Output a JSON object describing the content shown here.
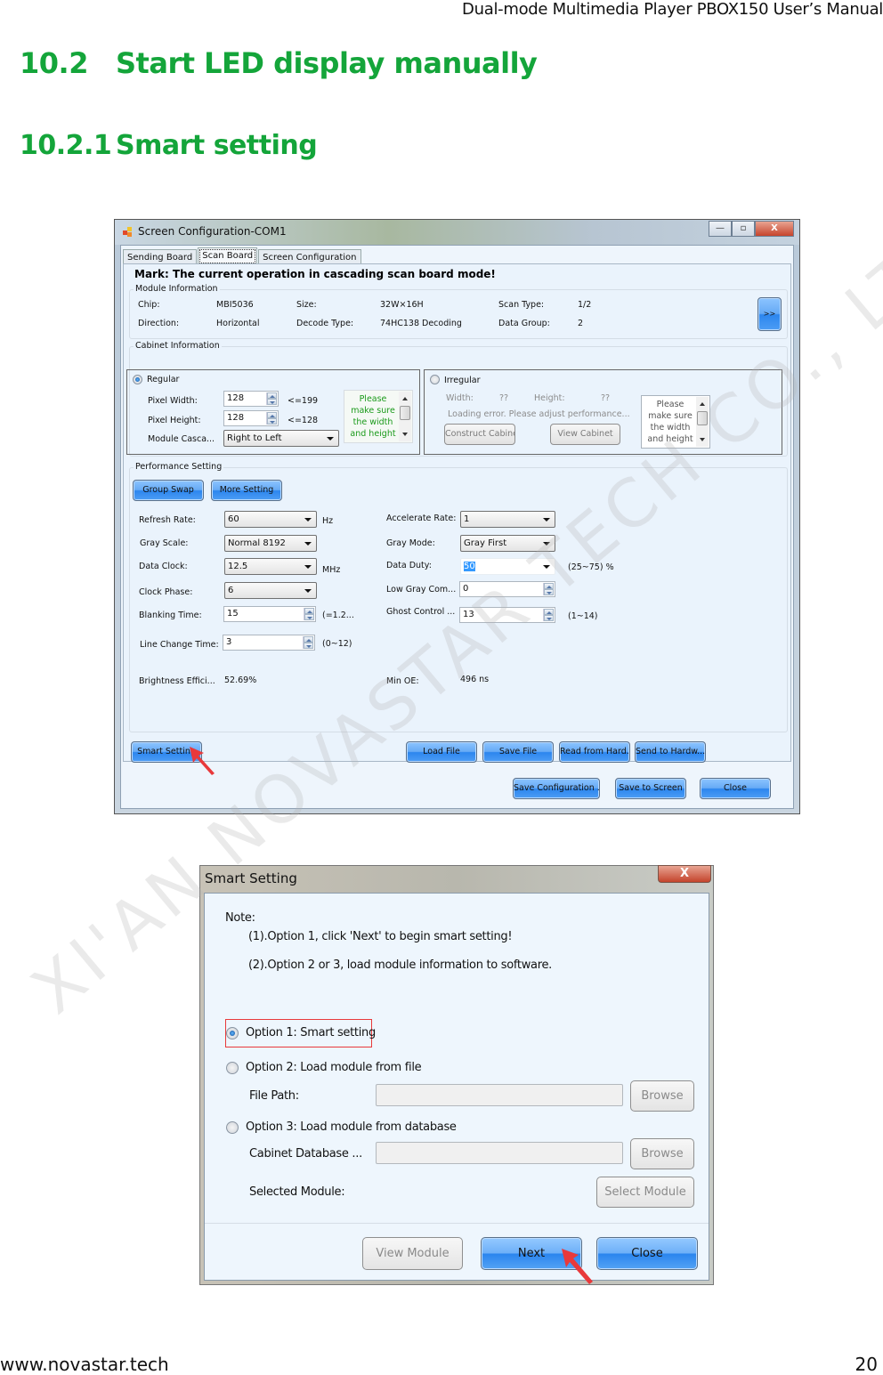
{
  "document": {
    "header": "Dual-mode Multimedia Player PBOX150 User’s Manual",
    "section": {
      "number": "10.2",
      "title": "Start LED display manually"
    },
    "subsection": {
      "number": "10.2.1",
      "title": "Smart setting"
    },
    "footer": {
      "website": "www.novastar.tech",
      "page": "20"
    },
    "watermark": "XI'AN NOVASTAR TECH CO., LTD"
  },
  "screen_config": {
    "title": "Screen Configuration-COM1",
    "window_buttons": {
      "minimize": "—",
      "maximize": "▫",
      "close": "X"
    },
    "tabs": [
      {
        "label": "Sending Board",
        "active": false
      },
      {
        "label": "Scan Board",
        "active": true
      },
      {
        "label": "Screen Configuration",
        "active": false
      }
    ],
    "mark": "Mark: The current operation in cascading scan board mode!",
    "module_info": {
      "label": "Module Information",
      "chip_label": "Chip:",
      "chip": "MBI5036",
      "size_label": "Size:",
      "size": "32W×16H",
      "scan_type_label": "Scan Type:",
      "scan_type": "1/2",
      "direction_label": "Direction:",
      "direction": "Horizontal",
      "decode_type_label": "Decode Type:",
      "decode_type": "74HC138 Decoding",
      "data_group_label": "Data Group:",
      "data_group": "2",
      "expand_button": ">>"
    },
    "cabinet_info": {
      "label": "Cabinet Information",
      "regular": {
        "label": "Regular",
        "selected": true,
        "pixel_width_label": "Pixel Width:",
        "pixel_width": "128",
        "pixel_width_limit": "<=199",
        "pixel_height_label": "Pixel Height:",
        "pixel_height": "128",
        "pixel_height_limit": "<=128",
        "cascade_label": "Module Casca...",
        "cascade": "Right to Left",
        "tip": [
          "Please",
          "make sure",
          "the width",
          "and height"
        ]
      },
      "irregular": {
        "label": "Irregular",
        "selected": false,
        "width_label": "Width:",
        "width": "??",
        "height_label": "Height:",
        "height": "??",
        "error": "Loading error. Please adjust performance...",
        "construct_button": "Construct Cabinet",
        "view_button": "View Cabinet",
        "tip": [
          "Please",
          "make sure",
          "the width",
          "and height"
        ]
      }
    },
    "performance": {
      "label": "Performance Setting",
      "group_swap_button": "Group Swap",
      "more_setting_button": "More Setting",
      "refresh_rate_label": "Refresh Rate:",
      "refresh_rate": "60",
      "refresh_rate_unit": "Hz",
      "gray_scale_label": "Gray Scale:",
      "gray_scale": "Normal 8192",
      "data_clock_label": "Data Clock:",
      "data_clock": "12.5",
      "data_clock_unit": "MHz",
      "clock_phase_label": "Clock Phase:",
      "clock_phase": "6",
      "blanking_time_label": "Blanking Time:",
      "blanking_time": "15",
      "blanking_time_range": "(=1.2...",
      "line_change_label": "Line Change Time:",
      "line_change": "3",
      "line_change_range": "(0~12)",
      "brightness_label": "Brightness Effici...",
      "brightness": "52.69%",
      "accelerate_label": "Accelerate Rate:",
      "accelerate": "1",
      "gray_mode_label": "Gray Mode:",
      "gray_mode": "Gray First",
      "data_duty_label": "Data Duty:",
      "data_duty": "50",
      "data_duty_range": "(25~75) %",
      "low_gray_label": "Low Gray Com...",
      "low_gray": "0",
      "ghost_label": "Ghost Control ...",
      "ghost": "13",
      "ghost_range": "(1~14)",
      "min_oe_label": "Min OE:",
      "min_oe": "496 ns"
    },
    "buttons": {
      "smart_setting": "Smart Setting",
      "load_file": "Load File",
      "save_file": "Save File",
      "read_hardware": "Read from Hard...",
      "send_hardware": "Send to Hardw...",
      "save_config": "Save Configuration ...",
      "save_screen": "Save to Screen",
      "close": "Close"
    }
  },
  "smart_setting": {
    "title": "Smart Setting",
    "close_button": "X",
    "note_label": "Note:",
    "note_1": "(1).Option 1, click 'Next' to begin smart setting!",
    "note_2": "(2).Option 2 or 3, load module information to software.",
    "option_1": {
      "label": "Option 1: Smart setting",
      "selected": true
    },
    "option_2": {
      "label": "Option 2: Load module from file",
      "selected": false
    },
    "file_path_label": "File Path:",
    "file_path": "",
    "browse_1": "Browse",
    "option_3": {
      "label": "Option 3: Load module from database",
      "selected": false
    },
    "cabinet_db_label": "Cabinet Database ...",
    "cabinet_db": "",
    "browse_2": "Browse",
    "selected_module_label": "Selected Module:",
    "select_module_button": "Select Module",
    "view_module_button": "View Module",
    "next_button": "Next",
    "close_label": "Close"
  },
  "colors": {
    "heading_green": "#14a53a",
    "button_blue": "#4d9df5",
    "annotation_red": "#e8393b"
  }
}
